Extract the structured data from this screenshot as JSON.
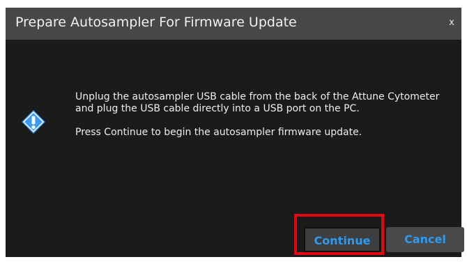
{
  "dialog": {
    "title": "Prepare Autosampler For Firmware Update",
    "close_label": "x",
    "icon": "info-exclamation-icon",
    "message_line1": "Unplug the autosampler USB cable from the back of the Attune Cytometer and plug the USB cable directly into a USB port on the PC.",
    "message_line2": "Press Continue to begin the autosampler firmware update.",
    "continue_label": "Continue",
    "cancel_label": "Cancel"
  },
  "colors": {
    "dialog_bg": "#1b1b1b",
    "titlebar_bg": "#474747",
    "button_text": "#2f9bf0",
    "icon_blue": "#2d8ef0",
    "highlight": "#e30613"
  }
}
